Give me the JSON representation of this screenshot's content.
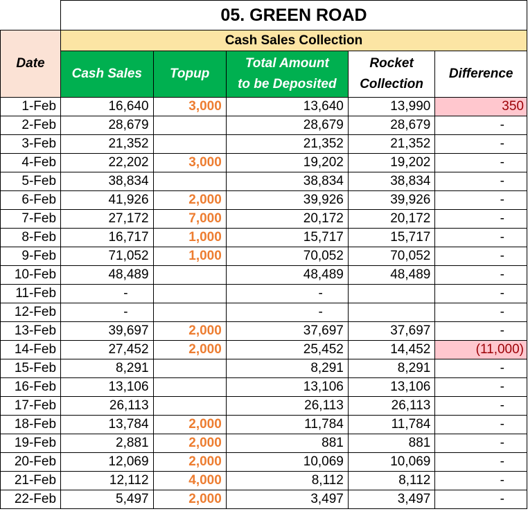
{
  "title": "05. GREEN ROAD",
  "section": "Cash Sales Collection",
  "headers": {
    "date": "Date",
    "cash_sales": "Cash Sales",
    "topup": "Topup",
    "total_line1": "Total Amount",
    "total_line2": "to be Deposited",
    "rocket_line1": "Rocket",
    "rocket_line2": "Collection",
    "difference": "Difference"
  },
  "colors": {
    "header_green": "#00b050",
    "section_yellow": "#fce5a4",
    "date_header_bg": "#fbe2d5",
    "topup_orange": "#ed7d31",
    "negative_bg": "#ffc7ce",
    "negative_text": "#9c0006"
  },
  "rows": [
    {
      "date": "1-Feb",
      "cash": "16,640",
      "topup": "3,000",
      "total": "13,640",
      "rocket": "13,990",
      "diff": "350",
      "flag": true
    },
    {
      "date": "2-Feb",
      "cash": "28,679",
      "topup": "",
      "total": "28,679",
      "rocket": "28,679",
      "diff": "-",
      "flag": false
    },
    {
      "date": "3-Feb",
      "cash": "21,352",
      "topup": "",
      "total": "21,352",
      "rocket": "21,352",
      "diff": "-",
      "flag": false
    },
    {
      "date": "4-Feb",
      "cash": "22,202",
      "topup": "3,000",
      "total": "19,202",
      "rocket": "19,202",
      "diff": "-",
      "flag": false
    },
    {
      "date": "5-Feb",
      "cash": "38,834",
      "topup": "",
      "total": "38,834",
      "rocket": "38,834",
      "diff": "-",
      "flag": false
    },
    {
      "date": "6-Feb",
      "cash": "41,926",
      "topup": "2,000",
      "total": "39,926",
      "rocket": "39,926",
      "diff": "-",
      "flag": false
    },
    {
      "date": "7-Feb",
      "cash": "27,172",
      "topup": "7,000",
      "total": "20,172",
      "rocket": "20,172",
      "diff": "-",
      "flag": false
    },
    {
      "date": "8-Feb",
      "cash": "16,717",
      "topup": "1,000",
      "total": "15,717",
      "rocket": "15,717",
      "diff": "-",
      "flag": false
    },
    {
      "date": "9-Feb",
      "cash": "71,052",
      "topup": "1,000",
      "total": "70,052",
      "rocket": "70,052",
      "diff": "-",
      "flag": false
    },
    {
      "date": "10-Feb",
      "cash": "48,489",
      "topup": "",
      "total": "48,489",
      "rocket": "48,489",
      "diff": "-",
      "flag": false
    },
    {
      "date": "11-Feb",
      "cash": "-",
      "topup": "",
      "total": "-",
      "rocket": "",
      "diff": "-",
      "flag": false
    },
    {
      "date": "12-Feb",
      "cash": "-",
      "topup": "",
      "total": "-",
      "rocket": "",
      "diff": "-",
      "flag": false
    },
    {
      "date": "13-Feb",
      "cash": "39,697",
      "topup": "2,000",
      "total": "37,697",
      "rocket": "37,697",
      "diff": "-",
      "flag": false
    },
    {
      "date": "14-Feb",
      "cash": "27,452",
      "topup": "2,000",
      "total": "25,452",
      "rocket": "14,452",
      "diff": "(11,000)",
      "flag": true
    },
    {
      "date": "15-Feb",
      "cash": "8,291",
      "topup": "",
      "total": "8,291",
      "rocket": "8,291",
      "diff": "-",
      "flag": false
    },
    {
      "date": "16-Feb",
      "cash": "13,106",
      "topup": "",
      "total": "13,106",
      "rocket": "13,106",
      "diff": "-",
      "flag": false
    },
    {
      "date": "17-Feb",
      "cash": "26,113",
      "topup": "",
      "total": "26,113",
      "rocket": "26,113",
      "diff": "-",
      "flag": false
    },
    {
      "date": "18-Feb",
      "cash": "13,784",
      "topup": "2,000",
      "total": "11,784",
      "rocket": "11,784",
      "diff": "-",
      "flag": false
    },
    {
      "date": "19-Feb",
      "cash": "2,881",
      "topup": "2,000",
      "total": "881",
      "rocket": "881",
      "diff": "-",
      "flag": false
    },
    {
      "date": "20-Feb",
      "cash": "12,069",
      "topup": "2,000",
      "total": "10,069",
      "rocket": "10,069",
      "diff": "-",
      "flag": false
    },
    {
      "date": "21-Feb",
      "cash": "12,112",
      "topup": "4,000",
      "total": "8,112",
      "rocket": "8,112",
      "diff": "-",
      "flag": false
    },
    {
      "date": "22-Feb",
      "cash": "5,497",
      "topup": "2,000",
      "total": "3,497",
      "rocket": "3,497",
      "diff": "-",
      "flag": false
    }
  ]
}
